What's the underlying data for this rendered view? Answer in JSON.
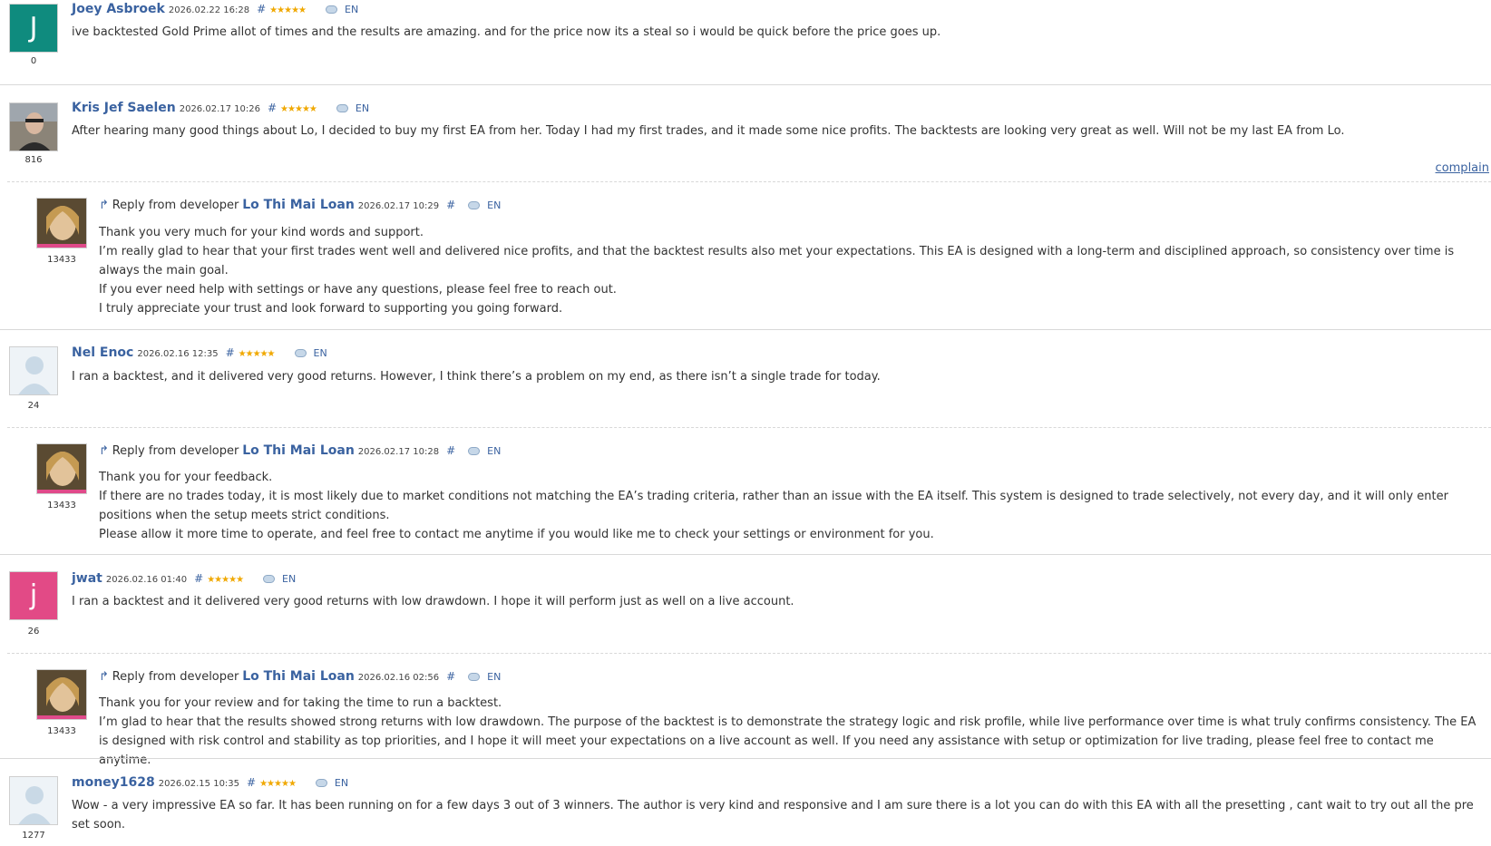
{
  "reviews": [
    {
      "author": "Joey Asbroek",
      "avatar_letter": "J",
      "date": "2026.02.22 16:28",
      "rating_stars": "★★★★★",
      "hash": "#",
      "lang": "EN",
      "count": "0",
      "text": "ive backtested Gold Prime allot of times and the results are amazing. and for the price now its a steal so i would be quick before the price goes up."
    },
    {
      "author": "Kris Jef Saelen",
      "date": "2026.02.17 10:26",
      "rating_stars": "★★★★★",
      "hash": "#",
      "lang": "EN",
      "count": "816",
      "text": "After hearing many good things about Lo, I decided to buy my first EA from her. Today I had my first trades, and it made some nice profits. The backtests are looking very great as well. Will not be my last EA from Lo.",
      "complain_label": "complain",
      "reply": {
        "prefix": "Reply from developer",
        "developer": "Lo Thi Mai Loan",
        "date": "2026.02.17 10:29",
        "hash": "#",
        "lang": "EN",
        "count": "13433",
        "lines": [
          "Thank you very much for your kind words and support.",
          "I’m really glad to hear that your first trades went well and delivered nice profits, and that the backtest results also met your expectations. This EA is designed with a long-term and disciplined approach, so consistency over time is always the main goal.",
          "If you ever need help with settings or have any questions, please feel free to reach out.",
          "I truly appreciate your trust and look forward to supporting you going forward."
        ]
      }
    },
    {
      "author": "Nel Enoc",
      "date": "2026.02.16 12:35",
      "rating_stars": "★★★★★",
      "hash": "#",
      "lang": "EN",
      "count": "24",
      "text": "I ran a backtest, and it delivered very good returns. However, I think there’s a problem on my end, as there isn’t a single trade for today.",
      "reply": {
        "prefix": "Reply from developer",
        "developer": "Lo Thi Mai Loan",
        "date": "2026.02.17 10:28",
        "hash": "#",
        "lang": "EN",
        "count": "13433",
        "lines": [
          "Thank you for your feedback.",
          "If there are no trades today, it is most likely due to market conditions not matching the EA’s trading criteria, rather than an issue with the EA itself. This system is designed to trade selectively, not every day, and it will only enter positions when the setup meets strict conditions.",
          "Please allow it more time to operate, and feel free to contact me anytime if you would like me to check your settings or environment for you."
        ]
      }
    },
    {
      "author": "jwat",
      "avatar_letter": "j",
      "date": "2026.02.16 01:40",
      "rating_stars": "★★★★★",
      "hash": "#",
      "lang": "EN",
      "count": "26",
      "text": "I ran a backtest and it delivered very good returns with low drawdown. I hope it will perform just as well on a live account.",
      "reply": {
        "prefix": "Reply from developer",
        "developer": "Lo Thi Mai Loan",
        "date": "2026.02.16 02:56",
        "hash": "#",
        "lang": "EN",
        "count": "13433",
        "lines": [
          "Thank you for your review and for taking the time to run a backtest.",
          "I’m glad to hear that the results showed strong returns with low drawdown. The purpose of the backtest is to demonstrate the strategy logic and risk profile, while live performance over time is what truly confirms consistency. The EA is designed with risk control and stability as top priorities, and I hope it will meet your expectations on a live account as well. If you need any assistance with setup or optimization for live trading, please feel free to contact me anytime."
        ]
      }
    },
    {
      "author": "money1628",
      "date": "2026.02.15 10:35",
      "rating_stars": "★★★★★",
      "hash": "#",
      "lang": "EN",
      "count": "1277",
      "text": "Wow - a very impressive EA so far. It has been running on for a few days 3 out of 3 winners. The author is very kind and responsive and I am sure there is a lot you can do with this EA with all the presetting , cant wait to try out all the pre set soon."
    }
  ]
}
